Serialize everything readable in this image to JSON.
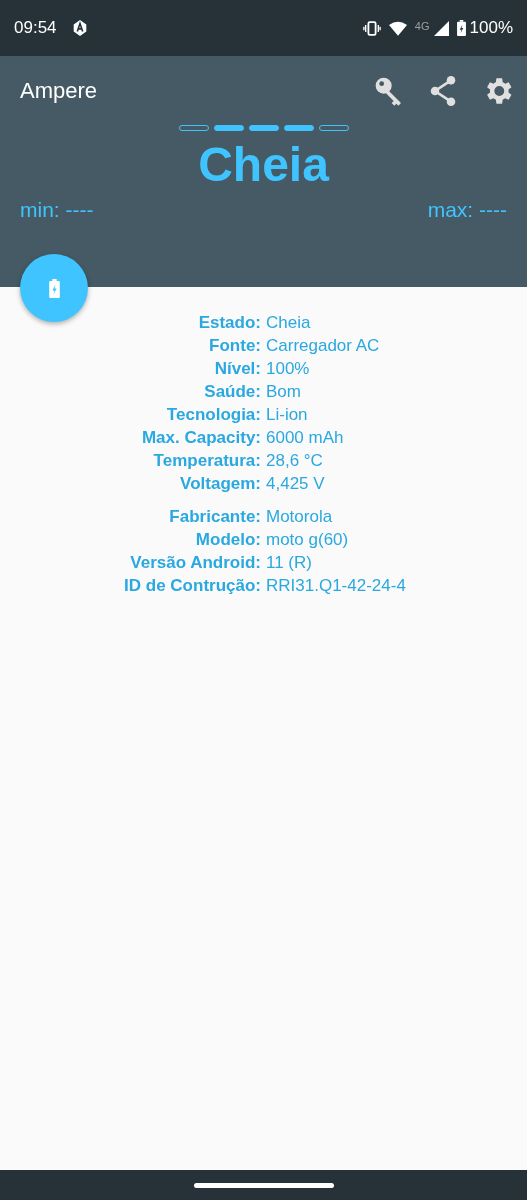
{
  "status_bar": {
    "time": "09:54",
    "network": "4G",
    "battery": "100%"
  },
  "app_bar": {
    "title": "Ampere"
  },
  "charge_indicator": [
    {
      "filled": false
    },
    {
      "filled": true
    },
    {
      "filled": true
    },
    {
      "filled": true
    },
    {
      "filled": false
    }
  ],
  "current_state": "Cheia",
  "min": "min: ----",
  "max": "max: ----",
  "info_groups": [
    [
      {
        "label": "Estado:",
        "value": "Cheia"
      },
      {
        "label": "Fonte:",
        "value": "Carregador AC"
      },
      {
        "label": "Nível:",
        "value": "100%"
      },
      {
        "label": "Saúde:",
        "value": "Bom"
      },
      {
        "label": "Tecnologia:",
        "value": "Li-ion"
      },
      {
        "label": "Max. Capacity:",
        "value": "6000 mAh"
      },
      {
        "label": "Temperatura:",
        "value": "28,6 °C"
      },
      {
        "label": "Voltagem:",
        "value": "4,425 V"
      }
    ],
    [
      {
        "label": "Fabricante:",
        "value": "Motorola"
      },
      {
        "label": "Modelo:",
        "value": "moto g(60)"
      },
      {
        "label": "Versão Android:",
        "value": "11 (R)"
      },
      {
        "label": "ID de Contrução:",
        "value": "RRI31.Q1-42-24-4"
      }
    ]
  ]
}
